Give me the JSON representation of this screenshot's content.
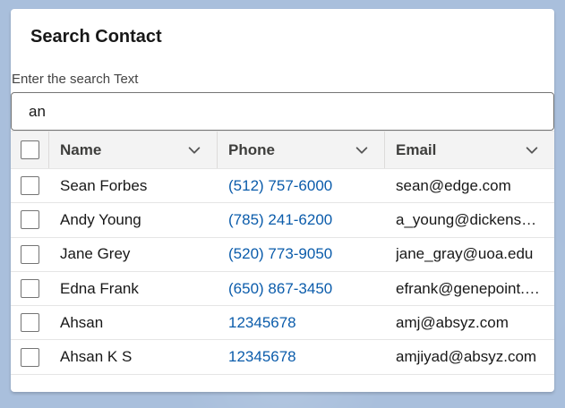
{
  "card": {
    "title": "Search Contact"
  },
  "search": {
    "label": "Enter the search Text",
    "value": "an"
  },
  "table": {
    "columns": [
      {
        "label": "Name"
      },
      {
        "label": "Phone"
      },
      {
        "label": "Email"
      }
    ],
    "rows": [
      {
        "name": "Sean Forbes",
        "phone": "(512) 757-6000",
        "email": "sean@edge.com"
      },
      {
        "name": "Andy Young",
        "phone": "(785) 241-6200",
        "email": "a_young@dickenson.com"
      },
      {
        "name": "Jane Grey",
        "phone": "(520) 773-9050",
        "email": "jane_gray@uoa.edu"
      },
      {
        "name": "Edna Frank",
        "phone": "(650) 867-3450",
        "email": "efrank@genepoint.com"
      },
      {
        "name": "Ahsan",
        "phone": "12345678",
        "email": "amj@absyz.com"
      },
      {
        "name": "Ahsan K S",
        "phone": "12345678",
        "email": "amjiyad@absyz.com"
      }
    ]
  },
  "colors": {
    "link": "#0b5cab",
    "header_bg": "#f3f3f3",
    "page_bg": "#a9bfdc"
  },
  "icons": {
    "column_menu": "chevron-down-icon"
  }
}
